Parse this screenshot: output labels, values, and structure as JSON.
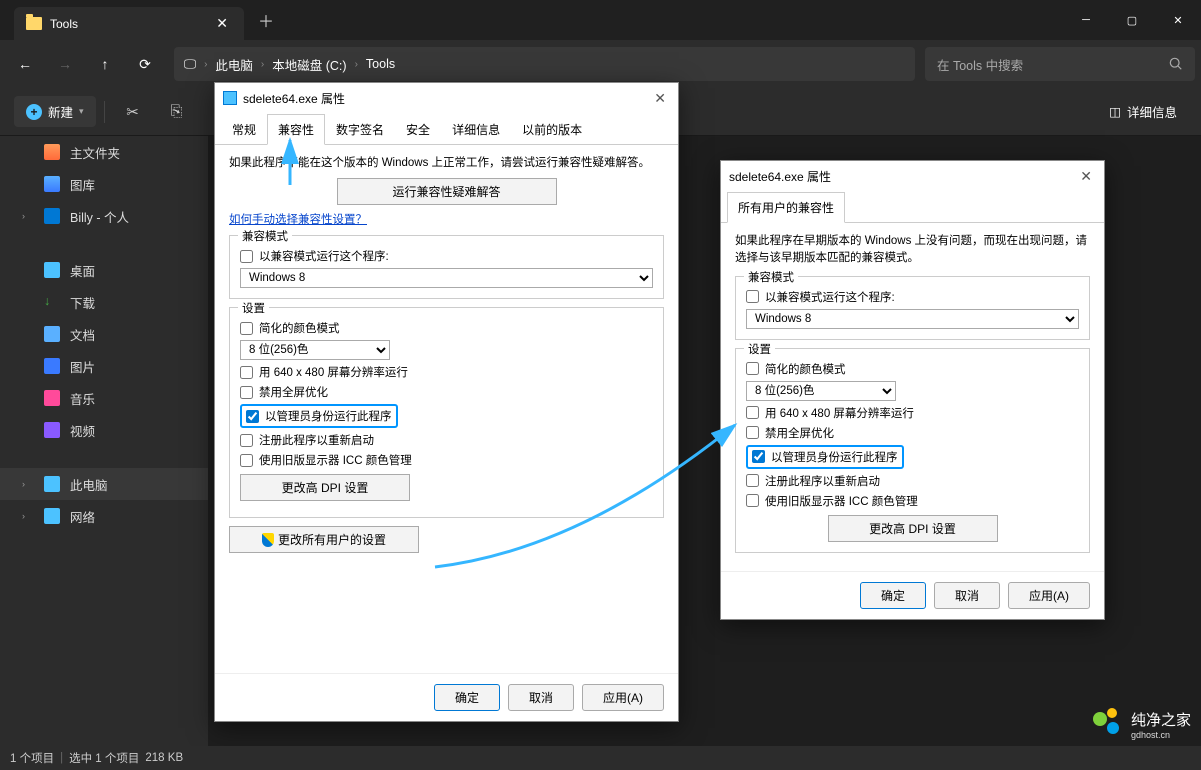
{
  "window": {
    "tab_title": "Tools"
  },
  "toolbar": {
    "breadcrumb_icon": "monitor"
  },
  "breadcrumb": {
    "pc": "此电脑",
    "drive": "本地磁盘 (C:)",
    "folder": "Tools"
  },
  "search": {
    "placeholder": "在 Tools 中搜索"
  },
  "ribbon": {
    "new": "新建",
    "details": "详细信息"
  },
  "sidebar": {
    "home": "主文件夹",
    "gallery": "图库",
    "onedrive": "Billy - 个人",
    "desktop": "桌面",
    "downloads": "下载",
    "documents": "文档",
    "pictures": "图片",
    "music": "音乐",
    "videos": "视频",
    "thispc": "此电脑",
    "network": "网络"
  },
  "dialog1": {
    "title": "sdelete64.exe 属性",
    "tabs": {
      "general": "常规",
      "compat": "兼容性",
      "sig": "数字签名",
      "security": "安全",
      "details": "详细信息",
      "prev": "以前的版本"
    },
    "body": {
      "desc": "如果此程序不能在这个版本的 Windows 上正常工作，请尝试运行兼容性疑难解答。",
      "troubleshoot": "运行兼容性疑难解答",
      "manual_link": "如何手动选择兼容性设置？",
      "compat_mode_legend": "兼容模式",
      "compat_mode_chk": "以兼容模式运行这个程序:",
      "compat_mode_val": "Windows 8",
      "settings_legend": "设置",
      "reduced_color": "简化的颜色模式",
      "color_val": "8 位(256)色",
      "lowres": "用 640 x 480 屏幕分辨率运行",
      "disable_fs": "禁用全屏优化",
      "run_admin": "以管理员身份运行此程序",
      "reg_restart": "注册此程序以重新启动",
      "legacy_icc": "使用旧版显示器 ICC 颜色管理",
      "change_dpi": "更改高 DPI 设置",
      "change_all": "更改所有用户的设置"
    },
    "buttons": {
      "ok": "确定",
      "cancel": "取消",
      "apply": "应用(A)"
    }
  },
  "dialog2": {
    "title": "sdelete64.exe 属性",
    "tab": "所有用户的兼容性",
    "desc": "如果此程序在早期版本的 Windows 上没有问题，而现在出现问题，请选择与该早期版本匹配的兼容模式。",
    "compat_mode_legend": "兼容模式",
    "compat_mode_chk": "以兼容模式运行这个程序:",
    "compat_mode_val": "Windows 8",
    "settings_legend": "设置",
    "reduced_color": "简化的颜色模式",
    "color_val": "8 位(256)色",
    "lowres": "用 640 x 480 屏幕分辨率运行",
    "disable_fs": "禁用全屏优化",
    "run_admin": "以管理员身份运行此程序",
    "reg_restart": "注册此程序以重新启动",
    "legacy_icc": "使用旧版显示器 ICC 颜色管理",
    "change_dpi": "更改高 DPI 设置",
    "buttons": {
      "ok": "确定",
      "cancel": "取消",
      "apply": "应用(A)"
    }
  },
  "statusbar": {
    "items": "1 个项目",
    "selected": "选中 1 个项目",
    "size": "218 KB"
  },
  "watermark": {
    "name": "纯净之家",
    "url": "gdhost.cn"
  }
}
